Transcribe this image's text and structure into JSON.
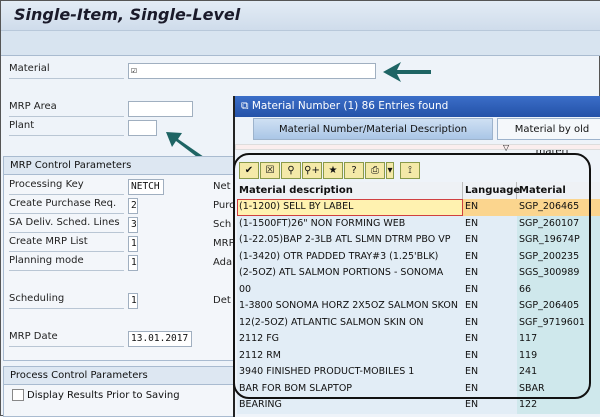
{
  "title": "Single-Item, Single-Level",
  "fields": {
    "material_label": "Material",
    "material_value": "☑",
    "mrp_area_label": "MRP Area",
    "mrp_area_value": "",
    "plant_label": "Plant",
    "plant_value": ""
  },
  "mrp_control": {
    "header": "MRP Control Parameters",
    "rows": [
      {
        "label": "Processing Key",
        "value": "NETCH",
        "right": "Net"
      },
      {
        "label": "Create Purchase Req.",
        "value": "2",
        "right": "Purc"
      },
      {
        "label": "SA Deliv. Sched. Lines",
        "value": "3",
        "right": "Sch"
      },
      {
        "label": "Create MRP List",
        "value": "1",
        "right": "MRP"
      },
      {
        "label": "Planning mode",
        "value": "1",
        "right": "Ada"
      },
      {
        "label": "Scheduling",
        "value": "1",
        "right": "Det"
      },
      {
        "label": "MRP Date",
        "value": "13.01.2017",
        "right": ""
      }
    ]
  },
  "process_control": {
    "header": "Process Control Parameters",
    "checkbox_label": "Display Results Prior to Saving",
    "checked": false
  },
  "popup": {
    "title": "Material Number (1)   86 Entries found",
    "tabs": [
      "Material Number/Material Description",
      "Material by old materi"
    ],
    "toolbar": [
      "✔",
      "☒",
      "⚲",
      "⚲+",
      "★",
      "?",
      "⎙",
      "▾",
      "⟟"
    ],
    "columns": [
      "Material description",
      "Language",
      "Material"
    ],
    "rows": [
      [
        "(1-1200) SELL BY LABEL",
        "EN",
        "SGP_206465"
      ],
      [
        "(1-1500FT)26\" NON FORMING WEB",
        "EN",
        "SGP_260107"
      ],
      [
        "(1-22.05)BAP 2-3LB ATL SLMN DTRM PBO VP",
        "EN",
        "SGR_19674P"
      ],
      [
        "(1-3420) OTR PADDED TRAY#3 (1.25'BLK)",
        "EN",
        "SGP_200235"
      ],
      [
        "(2-5OZ) ATL SALMON PORTIONS - SONOMA",
        "EN",
        "SGS_300989"
      ],
      [
        "00",
        "EN",
        "66"
      ],
      [
        "1-3800 SONOMA HORZ 2X5OZ SALMON SKON",
        "EN",
        "SGP_206405"
      ],
      [
        "12(2-5OZ) ATLANTIC SALMON SKIN ON",
        "EN",
        "SGF_9719601"
      ],
      [
        "2112 FG",
        "EN",
        "117"
      ],
      [
        "2112 RM",
        "EN",
        "119"
      ],
      [
        "3940 FINISHED PRODUCT-MOBILES 1",
        "EN",
        "241"
      ],
      [
        "BAR FOR BOM SLAPTOP",
        "EN",
        "SBAR"
      ],
      [
        "BEARING",
        "EN",
        "122"
      ]
    ]
  },
  "colors": {
    "arrow": "#1e6464",
    "popup_title": "#2d5cb5",
    "selected_row": "#fbd58e"
  }
}
